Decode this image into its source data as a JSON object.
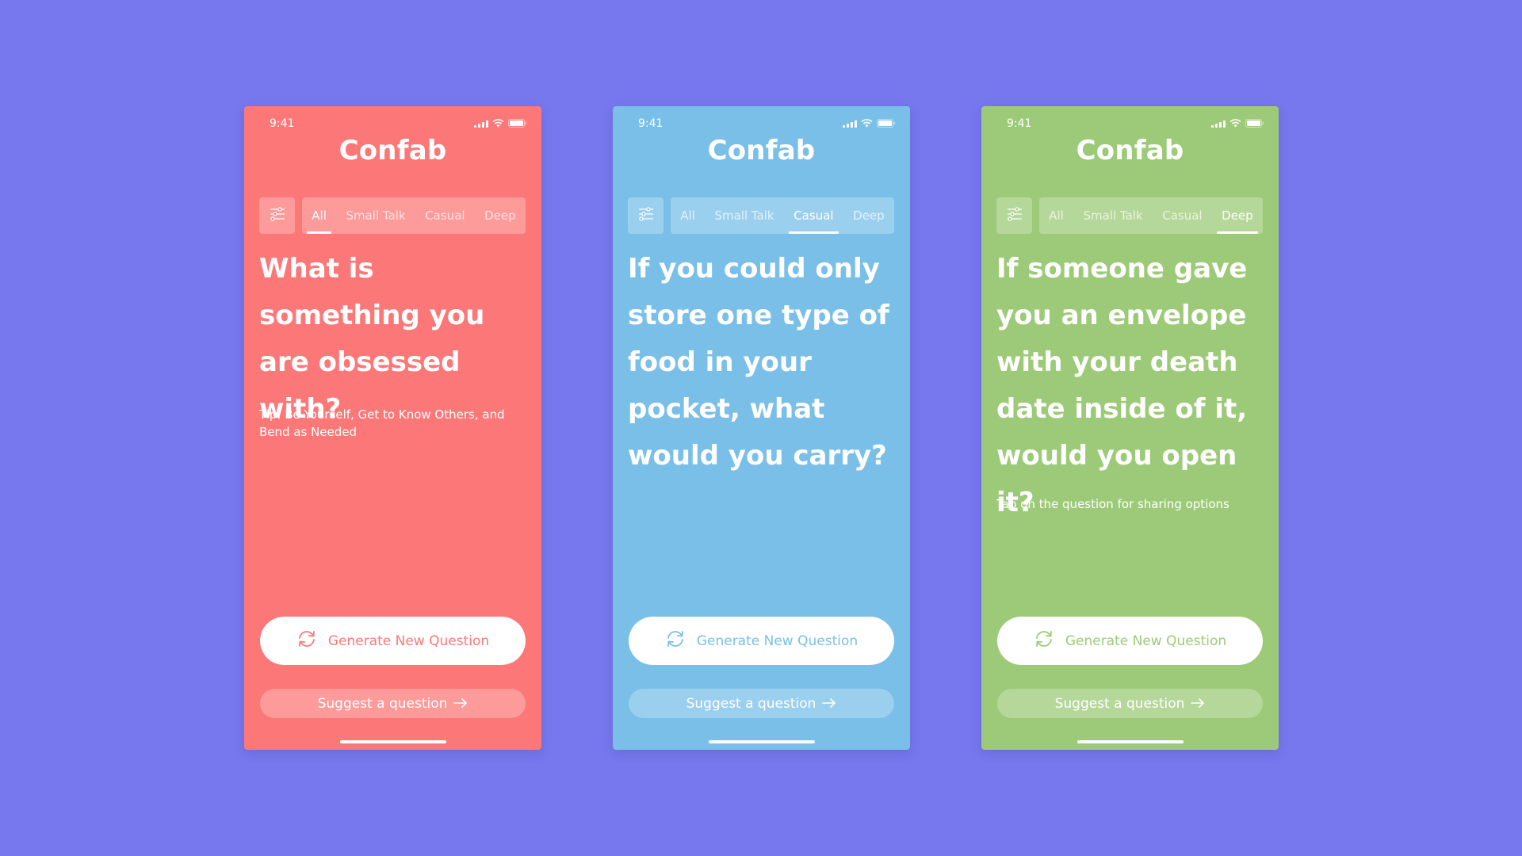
{
  "background_color": "#7878ee",
  "screens": [
    {
      "color": "#fc7878",
      "time": "9:41",
      "title": "Confab",
      "tabs": [
        "All",
        "Small Talk",
        "Casual",
        "Deep"
      ],
      "active_tab": 0,
      "question": "What is something you are obsessed with?",
      "tip": "Tip: Be Yourself, Get to Know Others, and Bend as Needed",
      "generate_label": "Generate New Question",
      "suggest_label": "Suggest a question",
      "icons": {
        "filter": "sliders-icon",
        "refresh": "refresh-icon",
        "arrow": "arrow-right-icon"
      }
    },
    {
      "color": "#7abfe8",
      "time": "9:41",
      "title": "Confab",
      "tabs": [
        "All",
        "Small Talk",
        "Casual",
        "Deep"
      ],
      "active_tab": 2,
      "question": "If you could only store one type of food in your pocket, what would you carry?",
      "tip": "",
      "generate_label": "Generate New Question",
      "suggest_label": "Suggest a question",
      "icons": {
        "filter": "sliders-icon",
        "refresh": "refresh-icon",
        "arrow": "arrow-right-icon"
      }
    },
    {
      "color": "#9dca78",
      "time": "9:41",
      "title": "Confab",
      "tabs": [
        "All",
        "Small Talk",
        "Casual",
        "Deep"
      ],
      "active_tab": 3,
      "question": "If someone gave you an envelope with your death date inside of it, would you open it?",
      "tip": "Tap on the question for sharing options",
      "generate_label": "Generate New Question",
      "suggest_label": "Suggest a question",
      "icons": {
        "filter": "sliders-icon",
        "refresh": "refresh-icon",
        "arrow": "arrow-right-icon"
      }
    }
  ]
}
